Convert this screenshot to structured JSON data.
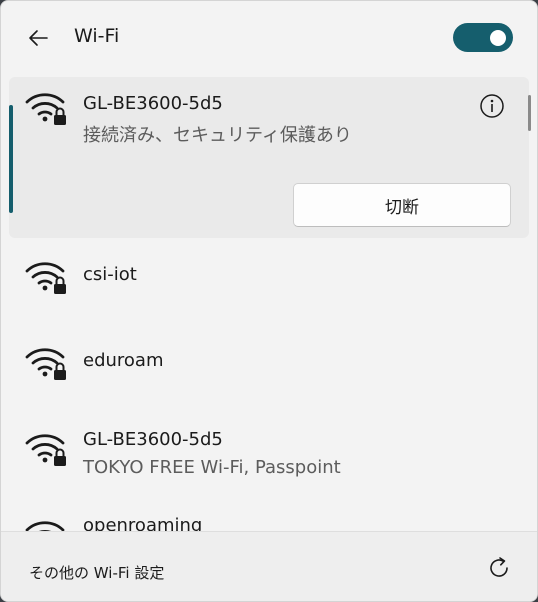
{
  "header": {
    "title": "Wi-Fi",
    "back_icon": "arrow-left-icon",
    "wifi_enabled": true,
    "accent_color": "#155e6d"
  },
  "networks": [
    {
      "name": "GL-BE3600-5d5",
      "status": "接続済み、セキュリティ保護あり",
      "secured": true,
      "connected": true,
      "disconnect_label": "切断"
    },
    {
      "name": "csi-iot",
      "secured": true
    },
    {
      "name": "eduroam",
      "secured": true
    },
    {
      "name": "GL-BE3600-5d5",
      "status": "TOKYO FREE Wi-Fi, Passpoint",
      "secured": true
    },
    {
      "name": "openroaming",
      "secured": true
    }
  ],
  "footer": {
    "settings_label": "その他の Wi-Fi 設定",
    "refresh_icon": "refresh-icon"
  }
}
